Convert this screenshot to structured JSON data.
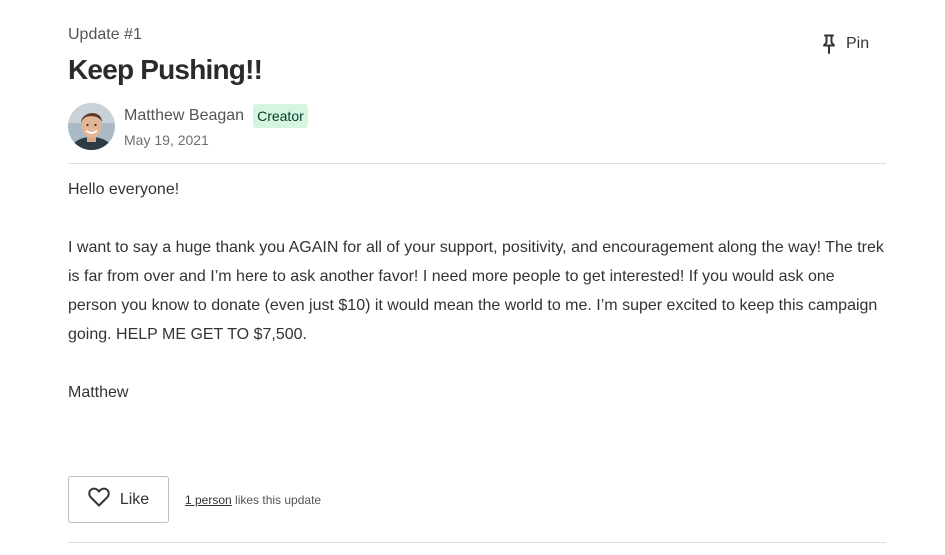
{
  "update": {
    "number_label": "Update #1",
    "title": "Keep Pushing!!"
  },
  "pin": {
    "icon": "pin-icon",
    "label": "Pin"
  },
  "author": {
    "name": "Matthew Beagan",
    "badge": "Creator",
    "date": "May 19, 2021",
    "badge_bg": "#d5f5e0",
    "badge_color": "#013d29"
  },
  "body": {
    "paragraphs": [
      "Hello everyone!",
      "I want to say a huge thank you AGAIN for all of your support, positivity, and encouragement along the way! The trek is far from over and I’m here to ask another favor! I need more people to get interested! If you would ask one person you know to donate (even just $10) it would mean the world to me. I’m super excited to keep this campaign going. HELP ME GET TO $7,500.",
      "Matthew"
    ]
  },
  "footer": {
    "like_icon": "heart-icon",
    "like_label": "Like",
    "likes_link": "1 person",
    "likes_suffix": " likes this update"
  }
}
